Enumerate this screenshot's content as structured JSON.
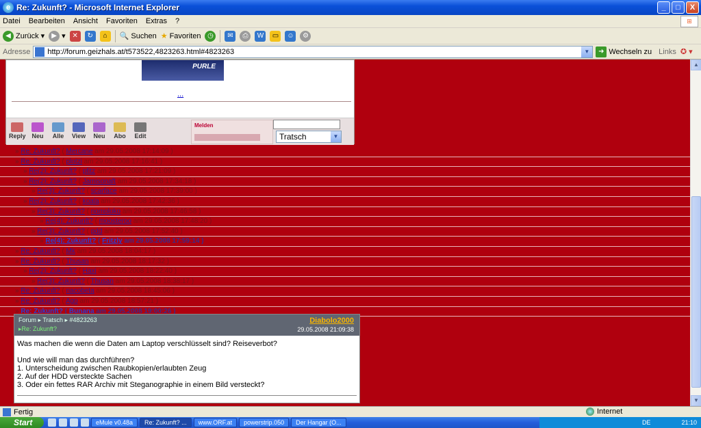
{
  "window": {
    "title": "Re: Zukunft? - Microsoft Internet Explorer",
    "controls": [
      "_",
      "□",
      "X"
    ]
  },
  "menu": [
    "Datei",
    "Bearbeiten",
    "Ansicht",
    "Favoriten",
    "Extras",
    "?"
  ],
  "toolbar": {
    "back": "Zurück",
    "search": "Suchen",
    "favorites": "Favoriten"
  },
  "address": {
    "label": "Adresse",
    "url": "http://forum.geizhals.at/t573522,4823263.html#4823263",
    "go": "Wechseln zu",
    "links": "Links"
  },
  "post_top": {
    "banner_text": "PURLE",
    "ellipsis": "...",
    "actions": [
      "Reply",
      "Neu",
      "Alle",
      "View",
      "Neu",
      "Abo",
      "Edit"
    ],
    "stop_label": "Melden",
    "forum_select": "Tratsch"
  },
  "thread": [
    {
      "indent": 0,
      "subject": "Re: Zukunft?",
      "author": "Mercane",
      "date": "29.05.2008 17:14:09"
    },
    {
      "indent": 0,
      "subject": "Re: Zukunft?",
      "author": "plotzi",
      "date": "29.05.2008 17:16:41"
    },
    {
      "indent": 1,
      "subject": "Re(2): Zukunft?",
      "author": "pfitz",
      "date": "29.05.2008 17:21:09"
    },
    {
      "indent": 1,
      "subject": "Re(2): Zukunft?",
      "author": "Jamisonaft",
      "date": "29.05.2008 17:34:18"
    },
    {
      "indent": 2,
      "subject": "Re(3): Zukunft?",
      "author": "scarface",
      "date": "29.05.2008 17:39:00"
    },
    {
      "indent": 1,
      "subject": "Re(2): Zukunft?",
      "author": "koala",
      "date": "29.05.2008 17:42:36"
    },
    {
      "indent": 2,
      "subject": "Re(3): Zukunft?",
      "author": "nomoloko",
      "date": "29.05.2008 17:46:58"
    },
    {
      "indent": 3,
      "subject": "Re(4): Zukunft?",
      "author": "moosteroo",
      "date": "29.05.2008 17:48:20"
    },
    {
      "indent": 2,
      "subject": "Re(3): Zukunft?",
      "author": "pdd",
      "date": "29.05.2008 17:52:40"
    },
    {
      "indent": 3,
      "subject": "Re(4): Zukunft?",
      "author": "Fritzly",
      "date": "29.05.2008 17:59:14",
      "active": true
    },
    {
      "indent": 0,
      "subject": "Re: Zukunft?",
      "author": "Mk",
      "date": "29.05.2008 18:04:17"
    },
    {
      "indent": 0,
      "subject": "Re: Zukunft?",
      "author": "Thusan",
      "date": "29.05.2008 18:17:32"
    },
    {
      "indent": 1,
      "subject": "Re(2): Zukunft?",
      "author": "Haxi",
      "date": "29.05.2008 18:22:40"
    },
    {
      "indent": 2,
      "subject": "Re(3): Zukunft?",
      "author": "Thusan",
      "date": "29.05.2008 18:38:17"
    },
    {
      "indent": 0,
      "subject": "Re: Zukunft?",
      "author": "nacobeta",
      "date": "29.05.2008 18:45:06"
    },
    {
      "indent": 0,
      "subject": "Re: Zukunft?",
      "author": "Ago",
      "date": "29.05.2008 18:57:21"
    },
    {
      "indent": 0,
      "subject": "Re: Zukunft?",
      "author": "Bunana",
      "date": "29.05.2008 19:00:26",
      "active": true
    }
  ],
  "message": {
    "crumb": "Forum ▸ Tratsch ▸ #4823263",
    "subject": "▸Re: Zukunft?",
    "author": "Diabolo2000",
    "date": "29.05.2008 21:09:38",
    "body": "Was machen die wenn die Daten am Laptop verschlüsselt sind? Reiseverbot?\n\nUnd wie will man das durchführen?\n1. Unterscheidung zwischen Raubkopien/erlaubten Zeug\n2. Auf der HDD versteckte Sachen\n3. Oder ein fettes RAR Archiv mit Steganographie in einem Bild versteckt?"
  },
  "status": {
    "left": "Fertig",
    "zone": "Internet"
  },
  "taskbar": {
    "start": "Start",
    "tasks": [
      "eMule v0.48a",
      "Re: Zukunft? ...",
      "www.ORF.at",
      "powerstrip.050",
      "Der Hangar (O..."
    ],
    "lang": "DE",
    "clock": "21:10"
  }
}
